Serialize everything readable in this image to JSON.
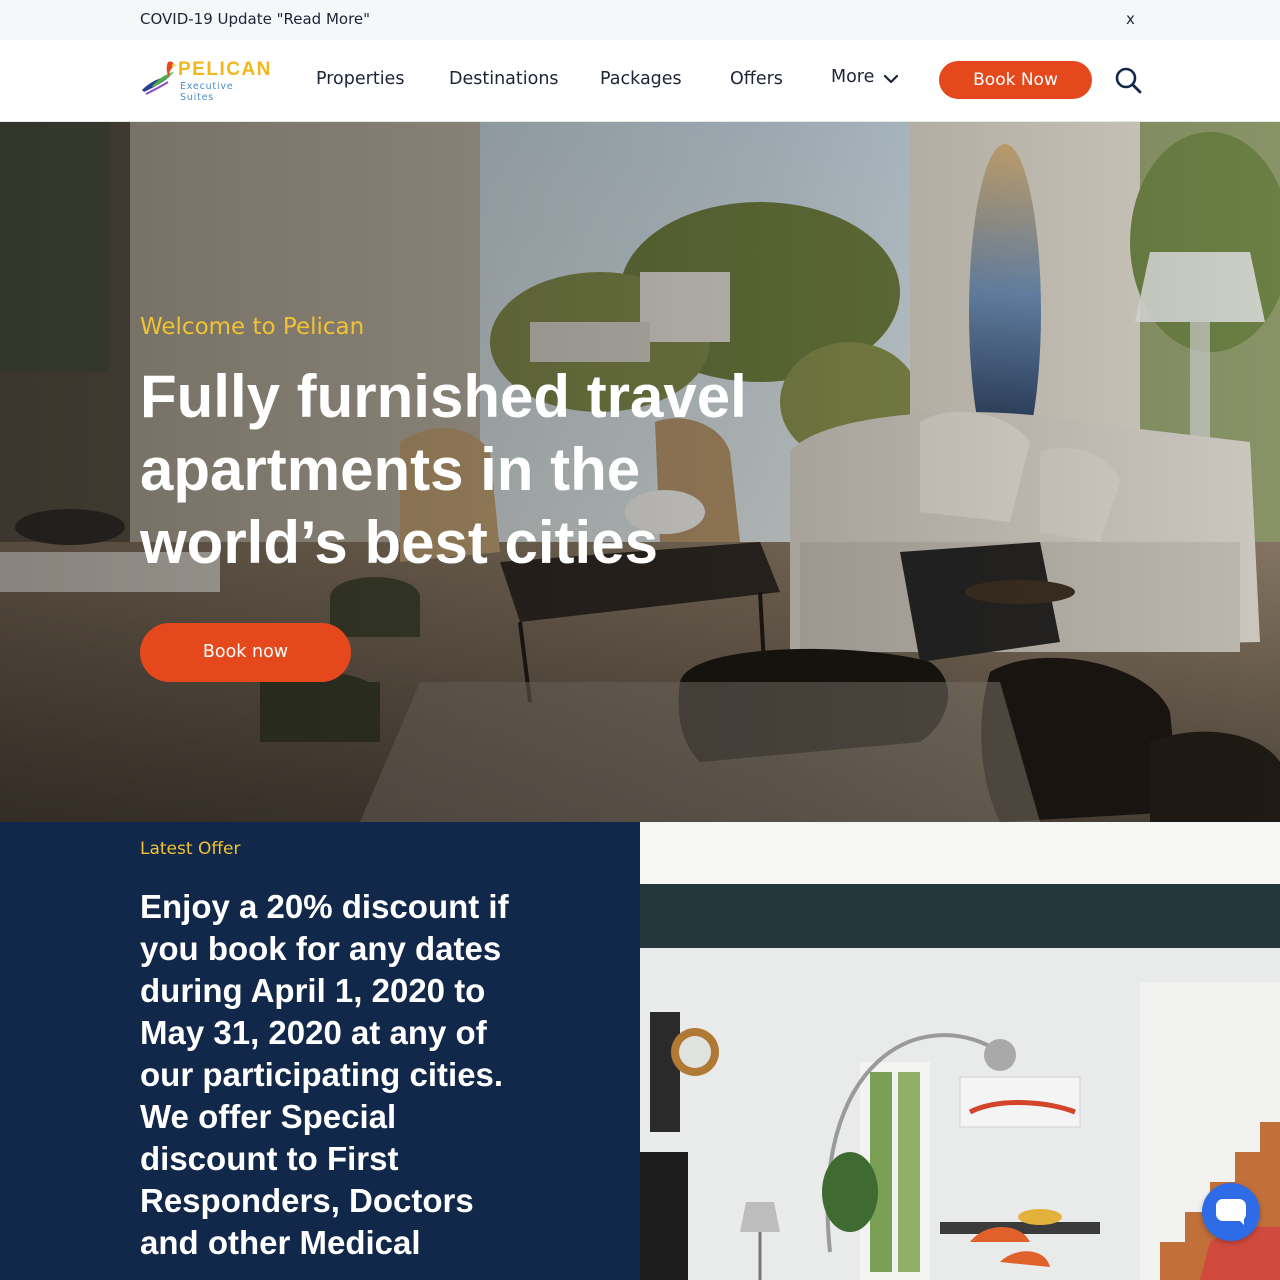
{
  "announcement": {
    "text": "COVID-19 Update \"Read More\"",
    "close_label": "x"
  },
  "brand": {
    "name": "PELICAN",
    "tagline": "Executive Suites"
  },
  "nav": {
    "items": [
      "Properties",
      "Destinations",
      "Packages",
      "Offers",
      "More"
    ],
    "book_label": "Book Now"
  },
  "hero": {
    "eyebrow": "Welcome to Pelican",
    "title": "Fully furnished travel apartments in the world’s best cities",
    "cta_label": "Book now"
  },
  "offer": {
    "label": "Latest Offer",
    "text": "Enjoy a 20% discount if you book for any dates during April 1, 2020 to May 31, 2020 at any of our participating cities. We offer Special discount to First Responders, Doctors and other Medical"
  },
  "colors": {
    "accent": "#e4481c",
    "gold": "#f1c232",
    "navy": "#11284a"
  },
  "icons": {
    "search": "search-icon",
    "dropdown": "chevron-down-icon",
    "chat": "chat-icon"
  }
}
